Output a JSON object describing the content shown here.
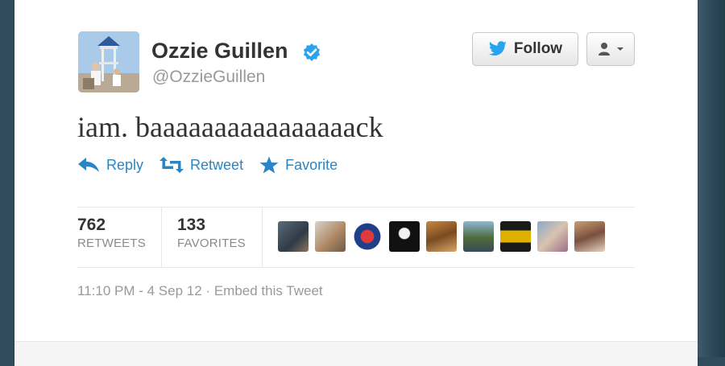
{
  "profile": {
    "name": "Ozzie Guillen",
    "handle": "@OzzieGuillen",
    "verified": true
  },
  "buttons": {
    "follow_label": "Follow",
    "follow_icon": "twitter-bird-icon",
    "user_menu_icon": "user-dropdown-icon"
  },
  "tweet": {
    "text": "iam. baaaaaaaaaaaaaaaack"
  },
  "actions": [
    {
      "label": "Reply",
      "icon": "reply-icon"
    },
    {
      "label": "Retweet",
      "icon": "retweet-icon"
    },
    {
      "label": "Favorite",
      "icon": "star-icon"
    }
  ],
  "stats": {
    "retweets": {
      "count": "762",
      "label": "RETWEETS"
    },
    "favorites": {
      "count": "133",
      "label": "FAVORITES"
    },
    "faces_shown": 9
  },
  "meta": {
    "time": "11:10 PM - 4 Sep 12",
    "separator": "·",
    "embed_label": "Embed this Tweet"
  },
  "colors": {
    "link_blue": "#2a85c4",
    "verified_blue": "#2aa3ef",
    "text_dark": "#333333",
    "text_muted": "#999999",
    "page_bg": "#2f4b5c"
  }
}
